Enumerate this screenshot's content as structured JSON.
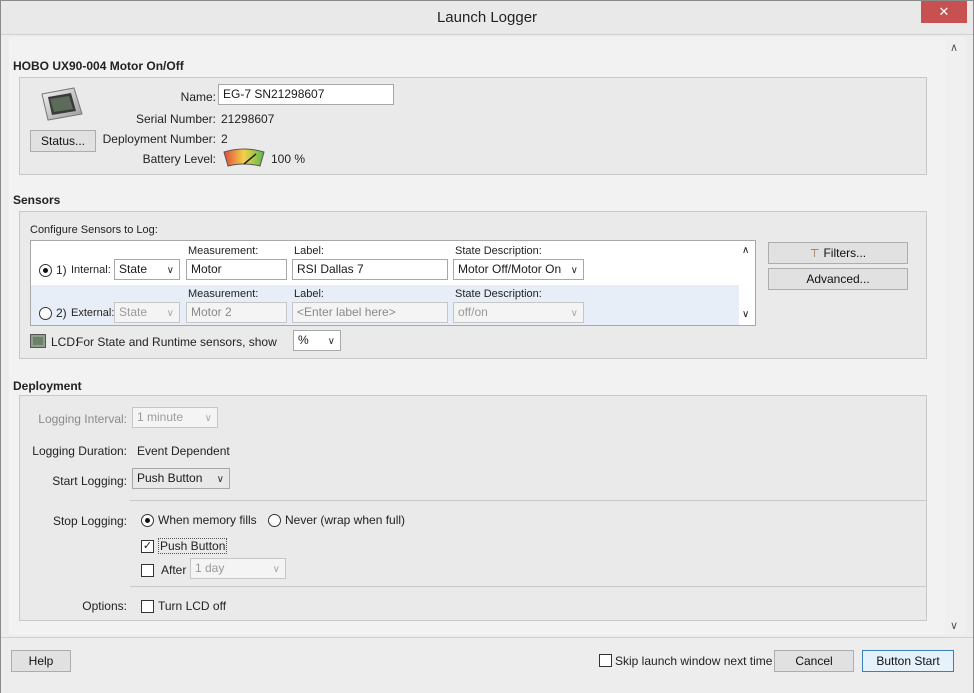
{
  "window": {
    "title": "Launch Logger",
    "close_glyph": "✕"
  },
  "device": {
    "heading": "HOBO UX90-004  Motor On/Off",
    "name_label": "Name:",
    "name_value": "EG-7 SN21298607",
    "serial_label": "Serial Number:",
    "serial_value": "21298607",
    "deployment_label": "Deployment Number:",
    "deployment_value": "2",
    "battery_label": "Battery Level:",
    "battery_value": "100 %",
    "status_button": "Status..."
  },
  "sensors": {
    "heading": "Sensors",
    "configure_label": "Configure Sensors to Log:",
    "col_measurement": "Measurement:",
    "col_label": "Label:",
    "col_state": "State Description:",
    "rows": [
      {
        "index": "1)",
        "type": "Internal:",
        "kind": "State",
        "measurement": "Motor",
        "label": "RSI Dallas 7",
        "state": "Motor Off/Motor On",
        "selected": true
      },
      {
        "index": "2)",
        "type": "External:",
        "kind": "State",
        "measurement": "Motor 2",
        "label": "<Enter label here>",
        "state": "off/on",
        "selected": false
      }
    ],
    "filters_button": "Filters...",
    "advanced_button": "Advanced...",
    "lcd_label": "LCD:",
    "lcd_text": "For State and Runtime sensors, show",
    "lcd_value": "%"
  },
  "deployment": {
    "heading": "Deployment",
    "interval_label": "Logging Interval:",
    "interval_value": "1 minute",
    "duration_label": "Logging Duration:",
    "duration_value": "Event Dependent",
    "start_label": "Start Logging:",
    "start_value": "Push Button",
    "stop_label": "Stop Logging:",
    "stop_option_memory": "When memory fills",
    "stop_option_never": "Never (wrap when full)",
    "push_button_label": "Push Button",
    "push_button_checked": true,
    "after_label": "After",
    "after_value": "1 day",
    "options_label": "Options:",
    "lcd_off_label": "Turn LCD off"
  },
  "footer": {
    "help": "Help",
    "skip_label": "Skip launch window next time",
    "cancel": "Cancel",
    "start": "Button Start"
  }
}
